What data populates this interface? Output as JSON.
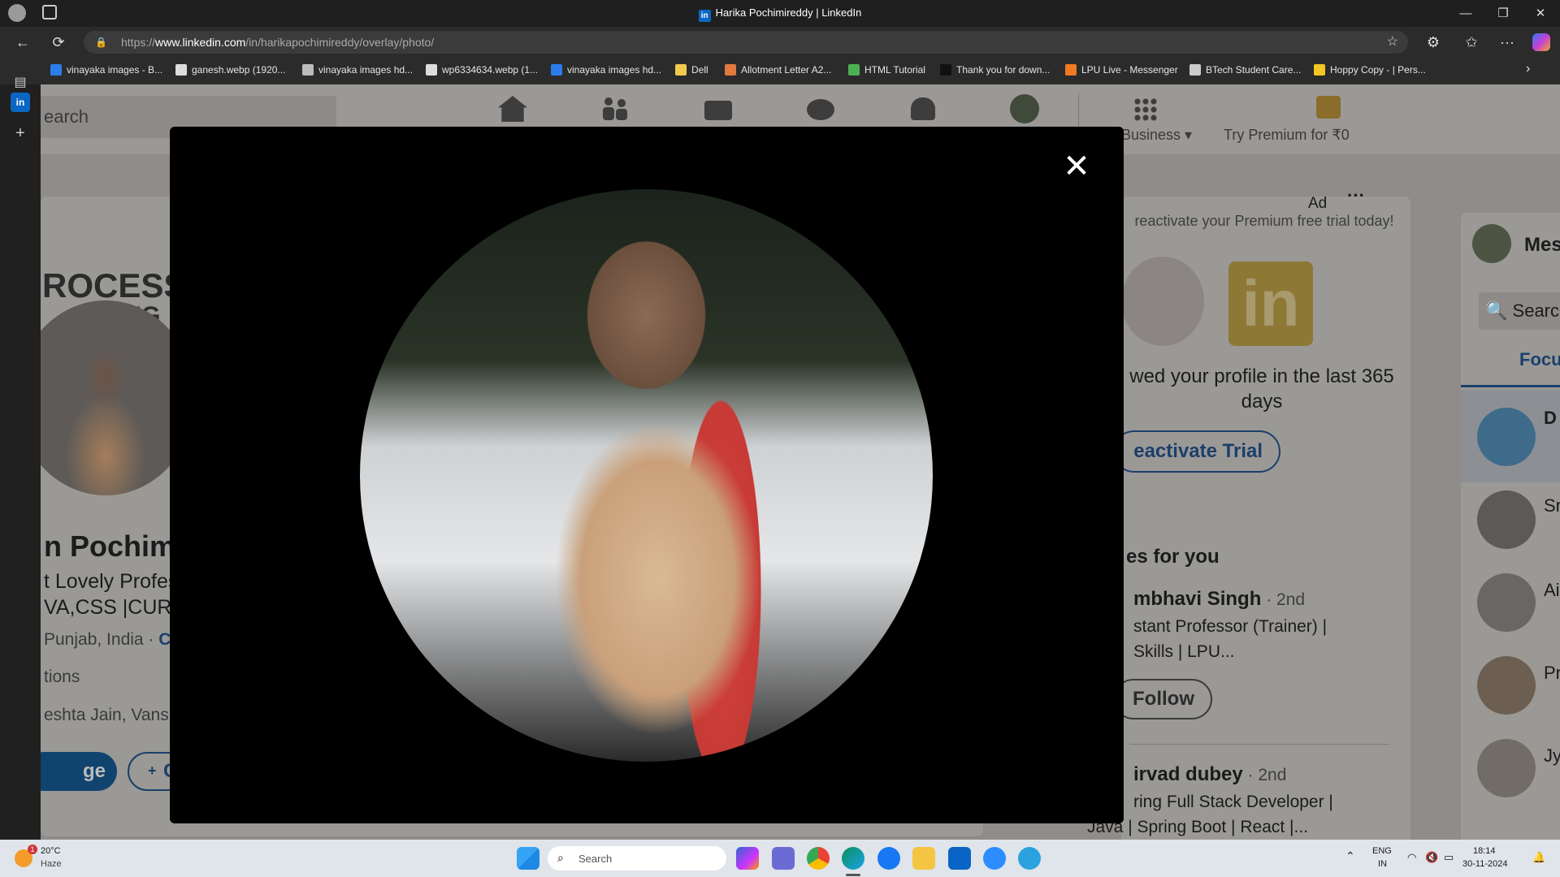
{
  "window": {
    "title": "Harika Pochimireddy | LinkedIn",
    "minimize": "—",
    "maximize": "❐",
    "close": "✕"
  },
  "browser": {
    "url_prefix": "https://",
    "url_domain": "www.linkedin.com",
    "url_path": "/in/harikapochimireddy/overlay/photo/",
    "back": "←",
    "refresh": "⟳",
    "more": "···"
  },
  "bookmarks": [
    {
      "label": "vinayaka images - B...",
      "color": "#2b7de9"
    },
    {
      "label": "ganesh.webp (1920...",
      "color": "#dddddd"
    },
    {
      "label": "vinayaka images hd...",
      "color": "#bbbbbb"
    },
    {
      "label": "wp6334634.webp (1...",
      "color": "#dddddd"
    },
    {
      "label": "vinayaka images hd...",
      "color": "#2b7de9"
    },
    {
      "label": "Dell",
      "color": "#f2c94c"
    },
    {
      "label": "Allotment Letter A2...",
      "color": "#e07a3f"
    },
    {
      "label": "HTML Tutorial",
      "color": "#4caf50"
    },
    {
      "label": "Thank you for down...",
      "color": "#111111"
    },
    {
      "label": "LPU Live - Messenger",
      "color": "#f07b22"
    },
    {
      "label": "BTech Student Care...",
      "color": "#cccccc"
    },
    {
      "label": "Hoppy Copy - | Pers...",
      "color": "#f3c623"
    }
  ],
  "linkedin": {
    "search_placeholder": "earch",
    "business_label": "Business ▾",
    "premium_label": "Try Premium for ₹0",
    "profile_banner_text": "ROCESS",
    "profile_banner_text2": "ING",
    "name_fragment": "n Pochimir",
    "headline_fragment": "t Lovely Profes",
    "headline_fragment2": "VA,CSS |CURIO",
    "location_fragment": "Punjab, India · ",
    "contact_fragment": "Co",
    "connections_fragment": "tions",
    "mutual_fragment": "eshta Jain, Vans",
    "message_button": "ge",
    "connect_button": "Con",
    "ad_label": "Ad",
    "ad_text": "reactivate your Premium free trial today!",
    "ad_views_text": "wed your profile in the last 365 days",
    "reactivate_button": "eactivate Trial",
    "people_title": "es for you",
    "person1_name": "mbhavi Singh",
    "person1_degree": " · 2nd",
    "person1_headline": "stant Professor (Trainer) |",
    "person1_headline2": "Skills | LPU...",
    "follow_button": "Follow",
    "person2_name": "irvad dubey",
    "person2_degree": " · 2nd",
    "person2_headline": "ring Full Stack Developer |",
    "person2_headline2": "Java | Spring Boot | React |...",
    "messaging_label": "Mes",
    "messaging_search": "Searc",
    "messaging_tab": "Focu",
    "msg_items": [
      "D",
      "Sr",
      "Ai",
      "Pr",
      "Jy"
    ]
  },
  "modal": {
    "close_icon": "✕"
  },
  "taskbar": {
    "weather_temp": "20°C",
    "weather_desc": "Haze",
    "weather_badge": "1",
    "search_placeholder": "Search",
    "lang_top": "ENG",
    "lang_bottom": "IN",
    "time": "18:14",
    "date": "30-11-2024"
  }
}
